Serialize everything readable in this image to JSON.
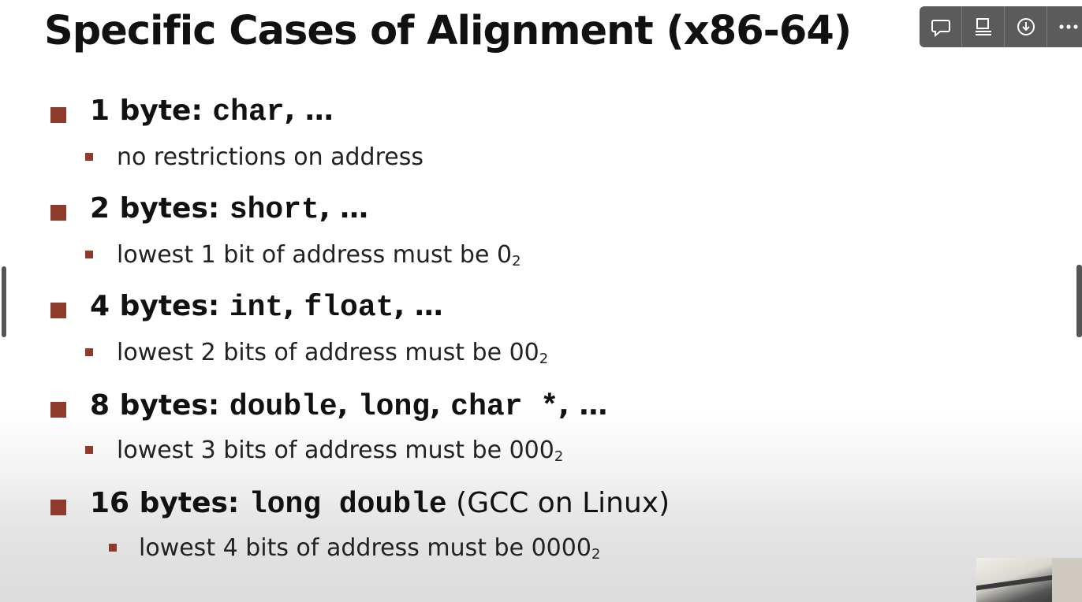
{
  "slide": {
    "title": "Specific Cases of Alignment (x86-64)",
    "items": [
      {
        "lead": "1 byte: ",
        "code": "char",
        "tail": ", …",
        "plain": "",
        "sub_text": "no restrictions on address",
        "sub_subscript": ""
      },
      {
        "lead": "2 bytes: ",
        "code": "short",
        "tail": ", …",
        "plain": "",
        "sub_text": "lowest 1 bit of address must be 0",
        "sub_subscript": "2"
      },
      {
        "lead": "4 bytes: ",
        "code": "int",
        "code2": "float",
        "tail": ", …",
        "plain": "",
        "sub_text": "lowest 2 bits of address must be 00",
        "sub_subscript": "2"
      },
      {
        "lead": "8 bytes: ",
        "code": "double",
        "code2": "long",
        "code3": "char *",
        "tail": ", …",
        "plain": "",
        "sub_text": "lowest 3 bits of address must be 000",
        "sub_subscript": "2"
      },
      {
        "lead": "16 bytes: ",
        "code": "long double",
        "tail": "",
        "plain": " (GCC on Linux)",
        "sub_text": "lowest 4 bits of address must be 0000",
        "sub_subscript": "2"
      }
    ]
  },
  "toolbar": {
    "buttons": [
      {
        "icon": "comment-icon"
      },
      {
        "icon": "presenter-icon"
      },
      {
        "icon": "download-icon"
      },
      {
        "icon": "more-icon"
      }
    ]
  },
  "colors": {
    "bullet": "#8e3b2b",
    "toolbar_bg": "#5b5b5b"
  }
}
